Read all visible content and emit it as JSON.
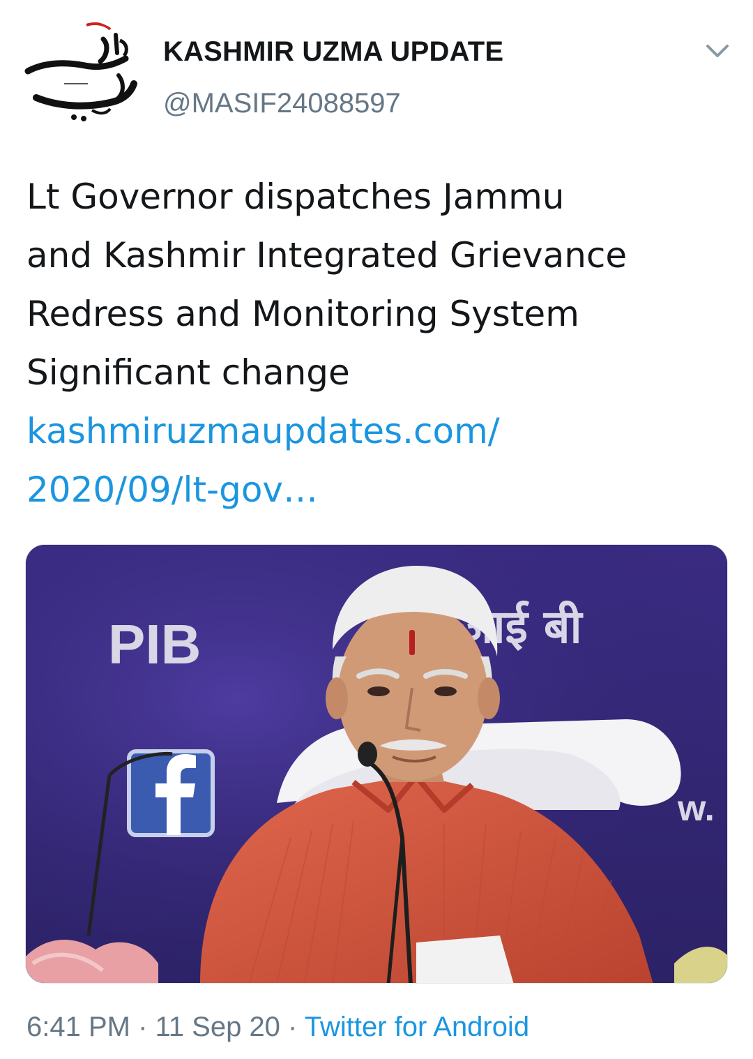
{
  "author": {
    "display_name": "KASHMIR UZMA UPDATE",
    "handle": "@MASIF24088597",
    "avatar_icon": "urdu-calligraphy-logo"
  },
  "menu": {
    "icon": "chevron-down-icon"
  },
  "tweet": {
    "text_lines": [
      "Lt Governor dispatches Jammu",
      "and Kashmir Integrated Grievance",
      "Redress and Monitoring System",
      "Significant change"
    ],
    "link_lines": [
      "kashmiruzmaupdates.com/",
      "2020/09/lt-gov…"
    ]
  },
  "media": {
    "backdrop_text_left": "PIB",
    "backdrop_text_right": "आई बी",
    "backdrop_text_edge": "w.",
    "facebook_icon": "facebook-icon"
  },
  "meta": {
    "time": "6:41 PM",
    "separator": " · ",
    "date": "11 Sep 20",
    "source": "Twitter for Android"
  },
  "colors": {
    "link": "#1b95e0",
    "secondary_text": "#657786",
    "primary_text": "#14171a",
    "backdrop": "#3b2f7a",
    "kurta": "#d4553e"
  }
}
